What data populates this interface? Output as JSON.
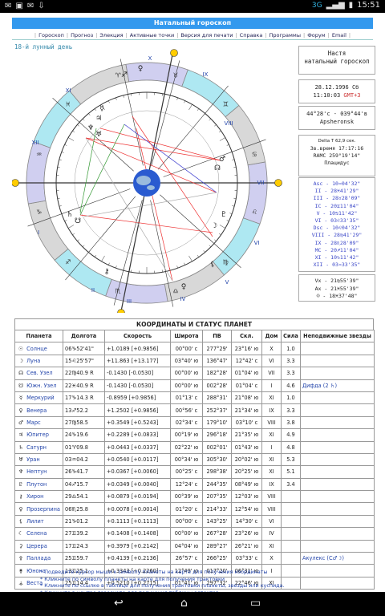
{
  "status": {
    "time": "15:51",
    "network": "3G",
    "left_icons": [
      "envelope-icon",
      "image-icon",
      "envelope-icon",
      "download-icon"
    ]
  },
  "header": {
    "title": "Натальный гороскоп",
    "nav": [
      "Гороскоп",
      "Прогноз",
      "Элекция",
      "Активные точки",
      "Версия для печати",
      "Справка",
      "Программы",
      "Форум",
      "Email"
    ],
    "moon_day": "18-й лунный день"
  },
  "person": {
    "name": "Настя",
    "type": "натальный гороскоп"
  },
  "datetime": {
    "date": "28.12.1996 Сб",
    "time": "11:10:03",
    "gmt": "GMT+3"
  },
  "place": {
    "coords": "44°28'c - 039°44'в",
    "city": "Apsheronsk"
  },
  "delta": {
    "delta_t": "Delta T  62,9 сек.",
    "sidereal": "Зв.время 17:17:16",
    "ramc": "RAMC 259°19'14\"",
    "system": "Плацидус"
  },
  "houses": [
    "Asc - 10♒04'32\"",
    "II - 28♓41'29\"",
    "III - 28♉28'09\"",
    "IC - 20♊11'04\"",
    "V - 10♋11'42\"",
    "VI - 03♌33'35\"",
    "Dsc - 10♌04'32\"",
    "VIII - 28♍41'29\"",
    "IX - 28♏28'09\"",
    "MC - 20♐11'04\"",
    "XI - 10♑11'42\"",
    "XII - 03♒33'35\""
  ],
  "vertex": [
    "Vx - 21♍55'39\"",
    "Ax - 21♓55'39\"",
    "☺ - 18♓37'48\""
  ],
  "chart_labels": {
    "houses": [
      "I",
      "II",
      "III",
      "IV",
      "V",
      "VI",
      "VII",
      "VIII",
      "IX",
      "X",
      "XI",
      "XII"
    ]
  },
  "table": {
    "title": "КООРДИНАТЫ И СТАТУС ПЛАНЕТ",
    "headers": [
      "Планета",
      "Долгота",
      "Скорость",
      "Широта",
      "ПВ",
      "Скл.",
      "Дом",
      "Сила",
      "Неподвижные звезды"
    ],
    "rows": [
      {
        "glyph": "☉",
        "name": "Солнце",
        "lon": "06♑52'41\"",
        "speed": "+1.0189 [+0.9856]",
        "lat": "00°00' с",
        "ra": "277°29'",
        "decl": "23°16' ю",
        "house": "X",
        "power": "1.0",
        "stars": ""
      },
      {
        "glyph": "☽",
        "name": "Луна",
        "lon": "15♌25'57\"",
        "speed": "+11.863 [+13.177]",
        "lat": "03°40' ю",
        "ra": "136°47'",
        "decl": "12°42' с",
        "house": "VI",
        "power": "3.3",
        "stars": ""
      },
      {
        "glyph": "☊",
        "name": "Сев. Узел",
        "lon": "22♍40.9 R",
        "speed": "-0.1430 [-0.0530]",
        "lat": "00°00' ю",
        "ra": "182°28'",
        "decl": "01°04' ю",
        "house": "VII",
        "power": "3.3",
        "stars": ""
      },
      {
        "glyph": "☋",
        "name": "Южн. Узел",
        "lon": "22♓40.9 R",
        "speed": "-0.1430 [-0.0530]",
        "lat": "00°00' ю",
        "ra": "002°28'",
        "decl": "01°04' с",
        "house": "I",
        "power": "4.6",
        "stars": "Дифда (2 ♄)"
      },
      {
        "glyph": "☿",
        "name": "Меркурий",
        "lon": "17♑14.3 R",
        "speed": "-0.8959 [+0.9856]",
        "lat": "01°13' с",
        "ra": "288°31'",
        "decl": "21°08' ю",
        "house": "XI",
        "power": "1.0",
        "stars": ""
      },
      {
        "glyph": "♀",
        "name": "Венера",
        "lon": "13♐52.2",
        "speed": "+1.2502 [+0.9856]",
        "lat": "00°56' с",
        "ra": "252°37'",
        "decl": "21°34' ю",
        "house": "IX",
        "power": "3.3",
        "stars": ""
      },
      {
        "glyph": "♂",
        "name": "Марс",
        "lon": "27♍58.5",
        "speed": "+0.3549 [+0.5243]",
        "lat": "02°34' с",
        "ra": "179°10'",
        "decl": "03°10' с",
        "house": "VIII",
        "power": "3.8",
        "stars": ""
      },
      {
        "glyph": "♃",
        "name": "Юпитер",
        "lon": "24♑19.6",
        "speed": "+0.2289 [+0.0833]",
        "lat": "00°19' ю",
        "ra": "296°18'",
        "decl": "21°35' ю",
        "house": "XI",
        "power": "4.9",
        "stars": ""
      },
      {
        "glyph": "♄",
        "name": "Сатурн",
        "lon": "01♈09.8",
        "speed": "+0.0443 [+0.0337]",
        "lat": "02°22' ю",
        "ra": "002°01'",
        "decl": "01°43' ю",
        "house": "I",
        "power": "4.8",
        "stars": ""
      },
      {
        "glyph": "♅",
        "name": "Уран",
        "lon": "03♒04.2",
        "speed": "+0.0540 [+0.0117]",
        "lat": "00°34' ю",
        "ra": "305°30'",
        "decl": "20°02' ю",
        "house": "XI",
        "power": "5.3",
        "stars": ""
      },
      {
        "glyph": "♆",
        "name": "Нептун",
        "lon": "26♑41.7",
        "speed": "+0.0367 [+0.0060]",
        "lat": "00°25' с",
        "ra": "298°38'",
        "decl": "20°25' ю",
        "house": "XI",
        "power": "5.1",
        "stars": ""
      },
      {
        "glyph": "♇",
        "name": "Плутон",
        "lon": "04♐15.7",
        "speed": "+0.0349 [+0.0040]",
        "lat": "12°24' с",
        "ra": "244°35'",
        "decl": "08°49' ю",
        "house": "IX",
        "power": "3.4",
        "stars": ""
      },
      {
        "glyph": "⚷",
        "name": "Хирон",
        "lon": "29♎54.1",
        "speed": "+0.0879 [+0.0194]",
        "lat": "00°39' ю",
        "ra": "207°35'",
        "decl": "12°03' ю",
        "house": "VIII",
        "power": "",
        "stars": ""
      },
      {
        "glyph": "♀",
        "name": "Прозерпина",
        "lon": "06♏25.8",
        "speed": "+0.0078 [+0.0014]",
        "lat": "01°20' с",
        "ra": "214°33'",
        "decl": "12°54' ю",
        "house": "VIII",
        "power": "",
        "stars": ""
      },
      {
        "glyph": "⚸",
        "name": "Лилит",
        "lon": "21♑01.2",
        "speed": "+0.1113 [+0.1113]",
        "lat": "00°00' с",
        "ra": "143°25'",
        "decl": "14°30' с",
        "house": "VI",
        "power": "",
        "stars": ""
      },
      {
        "glyph": "☾",
        "name": "Селена",
        "lon": "27♊39.2",
        "speed": "+0.1408 [+0.1408]",
        "lat": "00°00' ю",
        "ra": "267°28'",
        "decl": "23°26' ю",
        "house": "IV",
        "power": "",
        "stars": ""
      },
      {
        "glyph": "⚳",
        "name": "Церера",
        "lon": "17♊24.3",
        "speed": "+0.3979 [+0.2142]",
        "lat": "04°04' ю",
        "ra": "289°27'",
        "decl": "26°21' ю",
        "house": "XI",
        "power": "",
        "stars": ""
      },
      {
        "glyph": "⚴",
        "name": "Паллада",
        "lon": "25♊59.7",
        "speed": "+0.4139 [+0.2136]",
        "lat": "26°57' с",
        "ra": "266°25'",
        "decl": "03°33' с",
        "house": "X",
        "power": "",
        "stars": "Акулекс (С♂☽)"
      },
      {
        "glyph": "⚵",
        "name": "Юнона",
        "lon": "13♊25.1",
        "speed": "+0.3343 [+0.2260]",
        "lat": "12°49' ю",
        "ra": "017°20'",
        "decl": "06°31' ю",
        "house": "I",
        "power": "",
        "stars": ""
      },
      {
        "glyph": "⚶",
        "name": "Веста",
        "lon": "25♊14.4",
        "speed": "+0.5210 [+0.2715]",
        "lat": "01°41' ю",
        "ra": "297°32'",
        "decl": "22°46' ю",
        "house": "XI",
        "power": "",
        "stars": ""
      }
    ]
  },
  "notes": [
    "* Подведите курсор мыши к символу планеты на карте для получения координаты",
    "* Кликните по символу планеты на карте для получения трактовки",
    "* Кликните по ссылке в таблице для получения трактовки планеты, звезды или куспида.",
    "* Кликните в центре гороскопа для получения таблицы аспектов"
  ],
  "android_nav": [
    "back-icon",
    "home-icon",
    "recents-icon"
  ]
}
